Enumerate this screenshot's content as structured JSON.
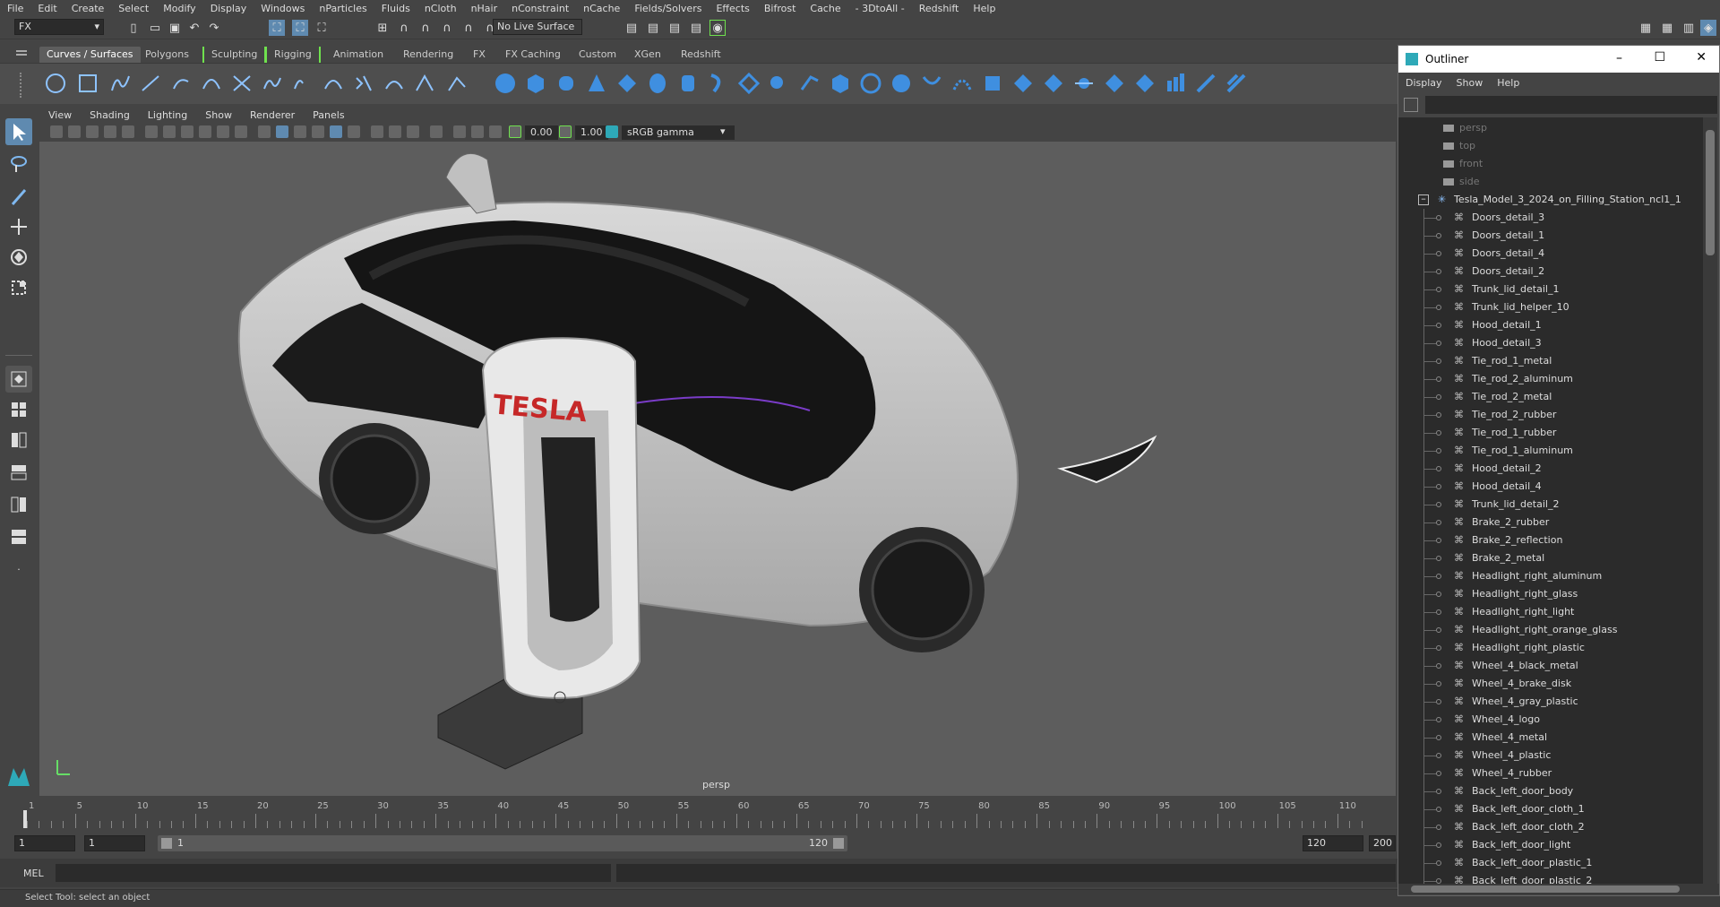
{
  "menubar": [
    "File",
    "Edit",
    "Create",
    "Select",
    "Modify",
    "Display",
    "Windows",
    "nParticles",
    "Fluids",
    "nCloth",
    "nHair",
    "nConstraint",
    "nCache",
    "Fields/Solvers",
    "Effects",
    "Bifrost",
    "Cache",
    "- 3DtoAll -",
    "Redshift",
    "Help"
  ],
  "statusline": {
    "menuset": "FX",
    "live_surface": "No Live Surface"
  },
  "shelf_tabs": [
    "Curves / Surfaces",
    "Polygons",
    "Sculpting",
    "Rigging",
    "Animation",
    "Rendering",
    "FX",
    "FX Caching",
    "Custom",
    "XGen",
    "Redshift"
  ],
  "panel_menu": [
    "View",
    "Shading",
    "Lighting",
    "Show",
    "Renderer",
    "Panels"
  ],
  "panel_tools": {
    "exposure": "0.00",
    "gamma": "1.00",
    "colorspace": "sRGB gamma"
  },
  "viewport": {
    "camera_label": "persp",
    "sign_text": "TESLA"
  },
  "timeline": {
    "ticks": [
      "1",
      "5",
      "10",
      "15",
      "20",
      "25",
      "30",
      "35",
      "40",
      "45",
      "50",
      "55",
      "60",
      "65",
      "70",
      "75",
      "80",
      "85",
      "90",
      "95",
      "100",
      "105",
      "110"
    ]
  },
  "range": {
    "start": "1",
    "current": "1",
    "slider_start": "1",
    "slider_end": "120",
    "end": "120",
    "max_end": "200"
  },
  "cmdline": {
    "label": "MEL"
  },
  "helpline": "Select Tool: select an object",
  "outliner": {
    "title": "Outliner",
    "menu": [
      "Display",
      "Show",
      "Help"
    ],
    "cameras": [
      "persp",
      "top",
      "front",
      "side"
    ],
    "root": "Tesla_Model_3_2024_on_Filling_Station_ncl1_1",
    "children": [
      "Doors_detail_3",
      "Doors_detail_1",
      "Doors_detail_4",
      "Doors_detail_2",
      "Trunk_lid_detail_1",
      "Trunk_lid_helper_10",
      "Hood_detail_1",
      "Hood_detail_3",
      "Tie_rod_1_metal",
      "Tie_rod_2_aluminum",
      "Tie_rod_2_metal",
      "Tie_rod_2_rubber",
      "Tie_rod_1_rubber",
      "Tie_rod_1_aluminum",
      "Hood_detail_2",
      "Hood_detail_4",
      "Trunk_lid_detail_2",
      "Brake_2_rubber",
      "Brake_2_reflection",
      "Brake_2_metal",
      "Headlight_right_aluminum",
      "Headlight_right_glass",
      "Headlight_right_light",
      "Headlight_right_orange_glass",
      "Headlight_right_plastic",
      "Wheel_4_black_metal",
      "Wheel_4_brake_disk",
      "Wheel_4_gray_plastic",
      "Wheel_4_logo",
      "Wheel_4_metal",
      "Wheel_4_plastic",
      "Wheel_4_rubber",
      "Back_left_door_body",
      "Back_left_door_cloth_1",
      "Back_left_door_cloth_2",
      "Back_left_door_light",
      "Back_left_door_plastic_1",
      "Back_left_door_plastic_2"
    ]
  },
  "colors": {
    "accent": "#5f8ab0",
    "green": "#6fe14e",
    "tesla_red": "#c62828"
  }
}
